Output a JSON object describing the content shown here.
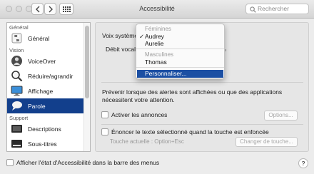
{
  "window": {
    "title": "Accessibilité"
  },
  "search": {
    "placeholder": "Rechercher"
  },
  "sidebar": {
    "sections": [
      {
        "header": "Général",
        "items": [
          "Général"
        ]
      },
      {
        "header": "Vision",
        "items": [
          "VoiceOver",
          "Réduire/agrandir",
          "Affichage",
          "Parole"
        ]
      },
      {
        "header": "Support",
        "items": [
          "Descriptions",
          "Sous-titres"
        ]
      }
    ],
    "selected": "Parole"
  },
  "main": {
    "voice_label": "Voix système :",
    "rate_label": "Débit vocal :",
    "alerts_description": "Prévenir lorsque des alertes sont affichées ou que des applications nécessitent votre attention.",
    "announcements_label": "Activer les annonces",
    "options_button": "Options...",
    "speak_selected_label": "Énoncer le texte sélectionné quand la touche est enfoncée",
    "current_key": "Touche actuelle : Option+Esc",
    "change_key_button": "Changer de touche..."
  },
  "voice_menu": {
    "female_header": "Féminines",
    "female": [
      "Audrey",
      "Aurelie"
    ],
    "checked": "Audrey",
    "male_header": "Masculines",
    "male": [
      "Thomas"
    ],
    "customize": "Personnaliser..."
  },
  "footer": {
    "show_status_label": "Afficher l'état d'Accessibilité dans la barre des menus",
    "help_label": "?"
  }
}
